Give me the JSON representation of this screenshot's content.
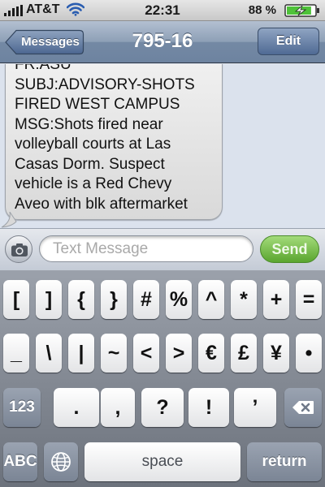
{
  "status_bar": {
    "carrier": "AT&T",
    "time": "22:31",
    "battery_percent": "88 %",
    "battery_level": 0.88,
    "signal_icon": "signal-bars-icon",
    "wifi_icon": "wifi-icon",
    "battery_icon": "battery-charging-icon"
  },
  "nav_bar": {
    "back_label": "Messages",
    "title": "795-16",
    "edit_label": "Edit"
  },
  "message": {
    "lines": [
      "FR:ASU",
      "SUBJ:ADVISORY-SHOTS",
      "FIRED WEST CAMPUS",
      "MSG:Shots fired near",
      "volleyball courts at Las",
      "Casas Dorm. Suspect",
      "vehicle is a Red Chevy",
      "Aveo with blk aftermarket"
    ]
  },
  "input_bar": {
    "camera_icon": "camera-icon",
    "placeholder": "Text Message",
    "send_label": "Send"
  },
  "keyboard": {
    "row1": [
      "[",
      "]",
      "{",
      "}",
      "#",
      "%",
      "^",
      "*",
      "+",
      "="
    ],
    "row2": [
      "_",
      "\\",
      "|",
      "~",
      "<",
      ">",
      "€",
      "£",
      "¥",
      "•"
    ],
    "row3_mode": "123",
    "row3": [
      ".",
      ",",
      "?",
      "!",
      "’"
    ],
    "delete_icon": "backspace-icon",
    "abc_label": "ABC",
    "globe_icon": "globe-icon",
    "space_label": "space",
    "return_label": "return"
  },
  "colors": {
    "nav_gradient_top": "#b3c0d1",
    "nav_gradient_bottom": "#6d83a0",
    "background": "#dbe2ed",
    "send_green": "#5aa52f",
    "keyboard_bg": "#6c727c"
  }
}
